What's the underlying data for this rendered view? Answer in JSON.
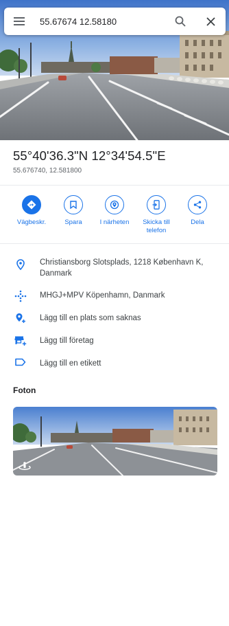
{
  "search": {
    "query": "55.67674 12.58180",
    "menu_icon": "menu-icon",
    "search_icon": "search-icon",
    "close_icon": "close-icon"
  },
  "place": {
    "title": "55°40'36.3\"N 12°34'54.5\"E",
    "decimal": "55.676740, 12.581800"
  },
  "actions": [
    {
      "label": "Vägbeskr.",
      "icon": "directions-icon"
    },
    {
      "label": "Spara",
      "icon": "bookmark-icon"
    },
    {
      "label": "I närheten",
      "icon": "nearby-icon"
    },
    {
      "label_line1": "Skicka till",
      "label_line2": "telefon",
      "icon": "send-to-phone-icon"
    },
    {
      "label": "Dela",
      "icon": "share-icon"
    }
  ],
  "details": [
    {
      "text_line1": "Christiansborg Slotsplads, 1218 København K,",
      "text_line2": "Danmark",
      "icon": "location-pin-icon"
    },
    {
      "text": "MHGJ+MPV Köpenhamn, Danmark",
      "icon": "plus-code-icon"
    },
    {
      "text": "Lägg till en plats som saknas",
      "icon": "add-place-icon"
    },
    {
      "text": "Lägg till företag",
      "icon": "add-business-icon"
    },
    {
      "text": "Lägg till en etikett",
      "icon": "label-icon"
    }
  ],
  "photos": {
    "section_title": "Foton",
    "badge_icon": "street-view-icon"
  },
  "colors": {
    "accent": "#1a73e8",
    "text_primary": "#202124",
    "text_secondary": "#5f6368",
    "divider": "#e8eaed"
  }
}
